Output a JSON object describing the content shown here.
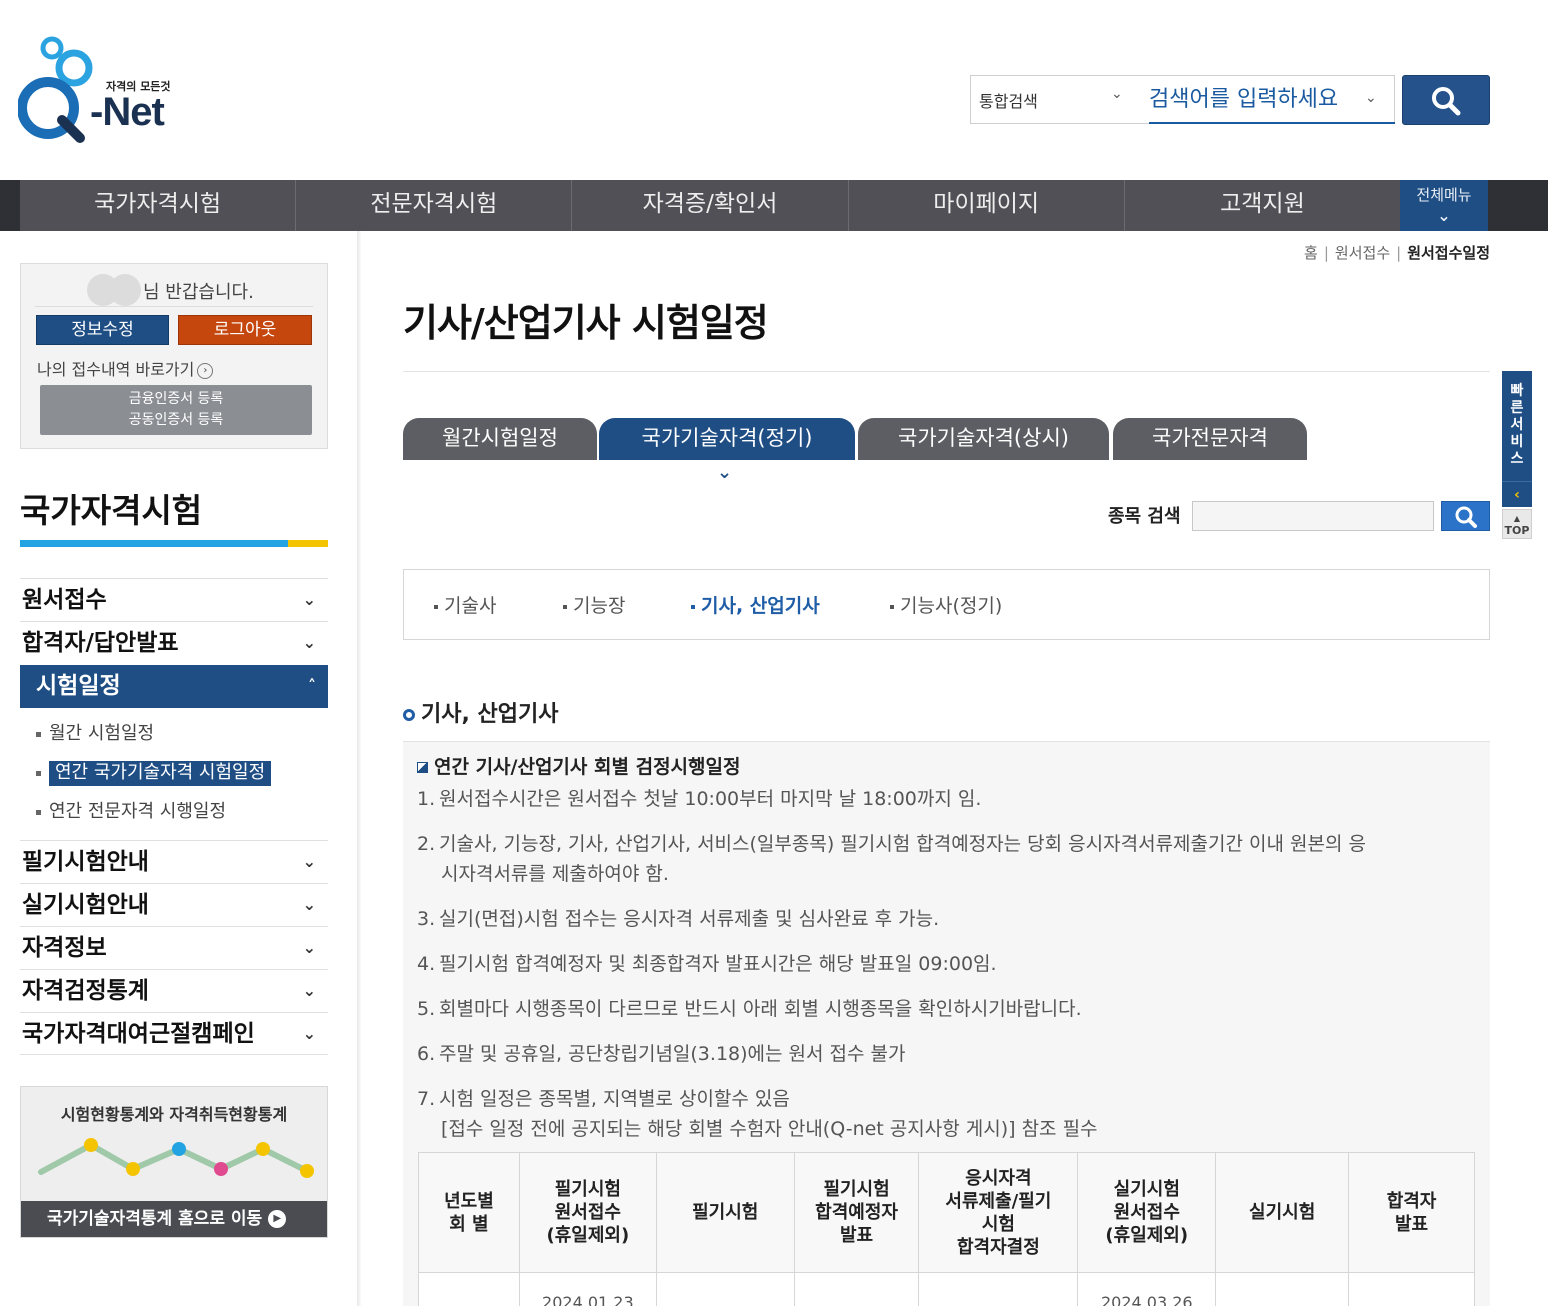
{
  "header": {
    "logo_tagline": "자격의 모든것",
    "logo_name": "-Net",
    "search_scope": "통합검색",
    "search_placeholder": "검색어를 입력하세요"
  },
  "gnb": {
    "items": [
      "국가자격시험",
      "전문자격시험",
      "자격증/확인서",
      "마이페이지",
      "고객지원"
    ],
    "all_menu": "전체메뉴"
  },
  "login": {
    "greeting": "님 반갑습니다.",
    "edit_label": "정보수정",
    "logout_label": "로그아웃",
    "my_apply": "나의 접수내역 바로가기",
    "cert_line1": "금융인증서 등록",
    "cert_line2": "공동인증서 등록"
  },
  "sidebar": {
    "title": "국가자격시험",
    "items": [
      {
        "label": "원서접수"
      },
      {
        "label": "합격자/답안발표"
      },
      {
        "label": "시험일정"
      },
      {
        "label": "필기시험안내"
      },
      {
        "label": "실기시험안내"
      },
      {
        "label": "자격정보"
      },
      {
        "label": "자격검정통계"
      },
      {
        "label": "국가자격대여근절캠페인"
      }
    ],
    "sub_items": [
      {
        "label": "월간 시험일정"
      },
      {
        "label": "연간 국가기술자격 시험일정"
      },
      {
        "label": "연간 전문자격 시행일정"
      }
    ],
    "banner_title": "시험현황통계와 자격취득현황통계",
    "banner_link": "국가기술자격통계 홈으로 이동"
  },
  "breadcrumb": {
    "home": "홈",
    "level1": "원서접수",
    "current": "원서접수일정"
  },
  "page": {
    "title": "기사/산업기사 시험일정",
    "tabs": [
      "월간시험일정",
      "국가기술자격(정기)",
      "국가기술자격(상시)",
      "국가전문자격"
    ],
    "item_search_label": "종목 검색",
    "subtabs": [
      "기술사",
      "기능장",
      "기사, 산업기사",
      "기능사(정기)"
    ],
    "section_title": "기사, 산업기사",
    "notice_title": "연간 기사/산업기사 회별 검정시행일정",
    "notices": [
      {
        "n": "1.",
        "text": "원서접수시간은 원서접수 첫날 10:00부터 마지막 날 18:00까지 임."
      },
      {
        "n": "2.",
        "text": "기술사, 기능장, 기사, 산업기사, 서비스(일부종목) 필기시험 합격예정자는 당회 응시자격서류제출기간 이내 원본의 응",
        "text2": "시자격서류를 제출하여야 함."
      },
      {
        "n": "3.",
        "text": "실기(면접)시험 접수는 응시자격 서류제출 및 심사완료 후 가능."
      },
      {
        "n": "4.",
        "text": "필기시험 합격예정자 및 최종합격자 발표시간은 해당 발표일 09:00임."
      },
      {
        "n": "5.",
        "text": "회별마다 시행종목이 다르므로 반드시 아래 회별 시행종목을 확인하시기바랍니다."
      },
      {
        "n": "6.",
        "text": "주말 및 공휴일, 공단창립기념일(3.18)에는 원서 접수 불가"
      },
      {
        "n": "7.",
        "text": "시험 일정은 종목별, 지역별로 상이할수 있음",
        "text2": "[접수 일정 전에 공지되는 해당 회별 수험자 안내(Q-net 공지사항 게시)] 참조 필수"
      }
    ],
    "table_headers": [
      [
        "년도별",
        "회 별"
      ],
      [
        "필기시험",
        "원서접수",
        "(휴일제외)"
      ],
      [
        "필기시험"
      ],
      [
        "필기시험",
        "합격예정자",
        "발표"
      ],
      [
        "응시자격",
        "서류제출/필기",
        "시험",
        "합격자결정"
      ],
      [
        "실기시험",
        "원서접수",
        "(휴일제외)"
      ],
      [
        "실기시험"
      ],
      [
        "합격자",
        "발표"
      ]
    ],
    "table_row1": [
      "",
      "2024.01.23",
      "",
      "",
      "",
      "2024.03.26",
      "",
      ""
    ]
  },
  "quick": {
    "label": "빠른서비스",
    "top": "TOP"
  },
  "colors": {
    "primary": "#1f4e85",
    "accent_orange": "#c5470e",
    "gnb_bg": "#505056",
    "cyan_bar": "#24a3e3",
    "yellow_bar": "#f5c400"
  }
}
